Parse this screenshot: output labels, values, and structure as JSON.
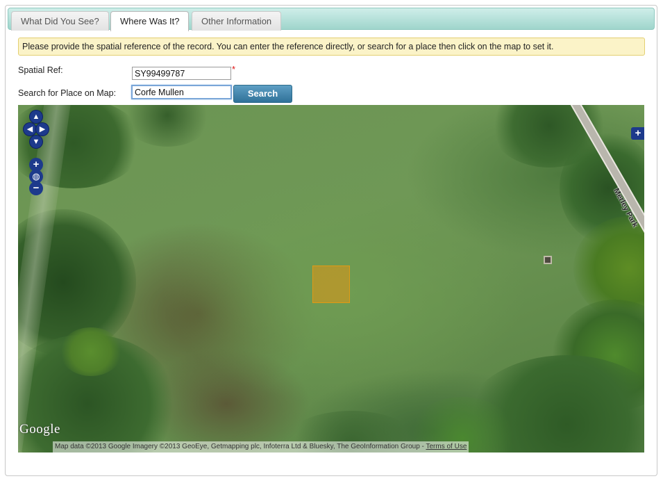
{
  "tabs": [
    {
      "label": "What Did You See?"
    },
    {
      "label": "Where Was It?"
    },
    {
      "label": "Other Information"
    }
  ],
  "active_tab": "Where Was It?",
  "notice": "Please provide the spatial reference of the record. You can enter the reference directly, or search for a place then click on the map to set it.",
  "form": {
    "spatial_ref_label": "Spatial Ref:",
    "spatial_ref_value": "SY99499787",
    "required_marker": "*",
    "search_label": "Search for Place on Map:",
    "search_value": "Corfe Mullen",
    "search_button": "Search"
  },
  "map": {
    "road_label": "Merley Park",
    "logo_text": "Google",
    "attribution": "Map data ©2013 Google Imagery ©2013 GeoEye, Getmapping plc, Infoterra Ltd & Bluesky, The GeoInformation Group - ",
    "terms_link": "Terms of Use",
    "controls": {
      "pan_up": "▲",
      "pan_left": "◀",
      "pan_right": "▶",
      "pan_down": "▼",
      "zoom_in": "+",
      "zoom_world": "◍",
      "zoom_out": "−",
      "layer_switcher": "+"
    }
  },
  "colors": {
    "tab_bar": "#9fd5cc",
    "notice_bg": "#fbf3c8",
    "button": "#2f7199",
    "marker": "#e19a14",
    "map_controls": "#1d3a8c"
  }
}
